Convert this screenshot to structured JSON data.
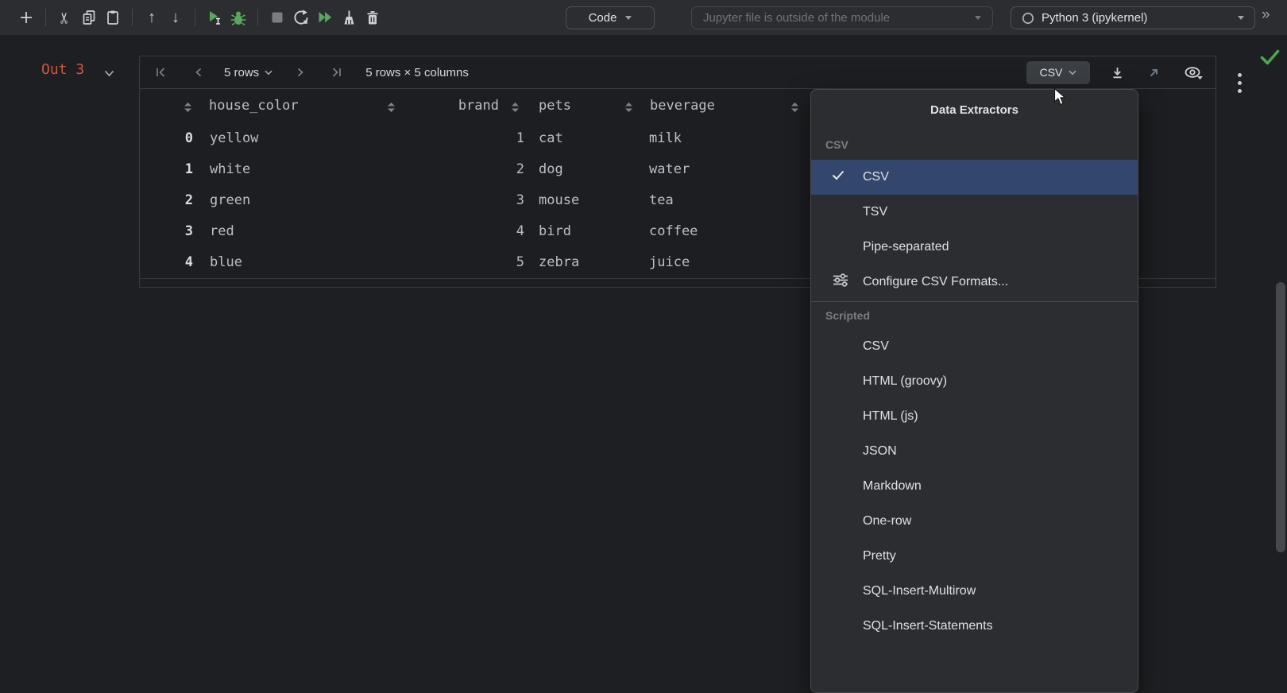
{
  "topbar": {
    "icons": [
      "add-cell",
      "cut",
      "copy",
      "paste",
      "move-cell-up",
      "move-cell-down",
      "run-cell",
      "debug-cell",
      "stop-kernel",
      "restart-kernel",
      "run-all",
      "clear-outputs",
      "delete-cell"
    ],
    "glyphs": {
      "cut": "✂",
      "up": "↑",
      "down": "↓",
      "overflow": "»"
    },
    "code_button": {
      "label": "Code"
    },
    "module_combo": {
      "label": "Jupyter file is outside of the module"
    },
    "kernel_combo": {
      "label": "Python 3 (ipykernel)"
    }
  },
  "output": {
    "label": "Out 3",
    "pager": {
      "rows_label": "5 rows",
      "summary": "5 rows × 5 columns"
    },
    "export_button": {
      "label": "CSV"
    }
  },
  "table": {
    "headers": [
      "house_color",
      "brand",
      "pets",
      "beverage"
    ],
    "rows": [
      {
        "index": "0",
        "house_color": "yellow",
        "brand": "1",
        "pets": "cat",
        "beverage": "milk"
      },
      {
        "index": "1",
        "house_color": "white",
        "brand": "2",
        "pets": "dog",
        "beverage": "water"
      },
      {
        "index": "2",
        "house_color": "green",
        "brand": "3",
        "pets": "mouse",
        "beverage": "tea"
      },
      {
        "index": "3",
        "house_color": "red",
        "brand": "4",
        "pets": "bird",
        "beverage": "coffee"
      },
      {
        "index": "4",
        "house_color": "blue",
        "brand": "5",
        "pets": "zebra",
        "beverage": "juice"
      }
    ]
  },
  "menu": {
    "title": "Data Extractors",
    "sections": [
      {
        "header": "CSV",
        "items": [
          {
            "label": "CSV",
            "selected": true
          },
          {
            "label": "TSV"
          },
          {
            "label": "Pipe-separated"
          },
          {
            "label": "Configure CSV Formats..."
          }
        ]
      },
      {
        "header": "Scripted",
        "items": [
          {
            "label": "CSV"
          },
          {
            "label": "HTML (groovy)"
          },
          {
            "label": "HTML (js)"
          },
          {
            "label": "JSON"
          },
          {
            "label": "Markdown"
          },
          {
            "label": "One-row"
          },
          {
            "label": "Pretty"
          },
          {
            "label": "SQL-Insert-Multirow"
          },
          {
            "label": "SQL-Insert-Statements"
          }
        ]
      }
    ]
  },
  "colors": {
    "selection_blue": "#33466B",
    "run_green": "#57A85C",
    "out_label_red": "#CC5742",
    "success_green": "#4CA64F",
    "toolbar_bg": "#2B2D30",
    "editor_bg": "#1E1F22"
  }
}
